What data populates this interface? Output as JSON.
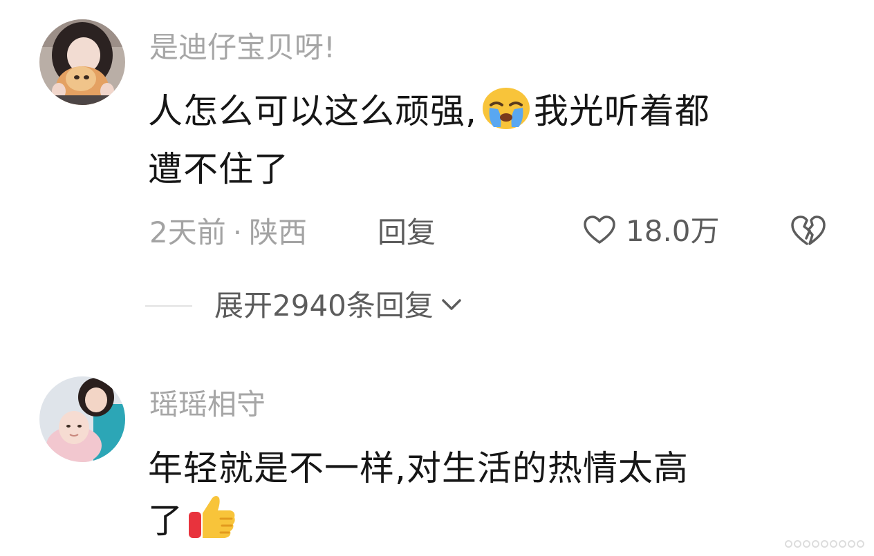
{
  "comments": [
    {
      "username": "是迪仔宝贝呀!",
      "text_line1": "人怎么可以这么顽强,",
      "emoji": "loudly-crying-face-emoji",
      "text_line1_after": "我光听着都",
      "text_line2": "遭不住了",
      "time_location": "2天前",
      "separator": "·",
      "location": "陕西",
      "reply_label": "回复",
      "like_count": "18.0万",
      "expand_label": "展开2940条回复"
    },
    {
      "username": "瑶瑶相守",
      "text_line1": "年轻就是不一样,对生活的热情太高",
      "text_line2": "了",
      "emoji": "thumbs-up-emoji"
    }
  ],
  "icons": {
    "like": "heart-outline-icon",
    "dislike": "broken-heart-icon",
    "expand": "chevron-down-icon"
  },
  "colors": {
    "username": "#a6a6a6",
    "content": "#161616",
    "secondary": "#5c5c5c"
  }
}
